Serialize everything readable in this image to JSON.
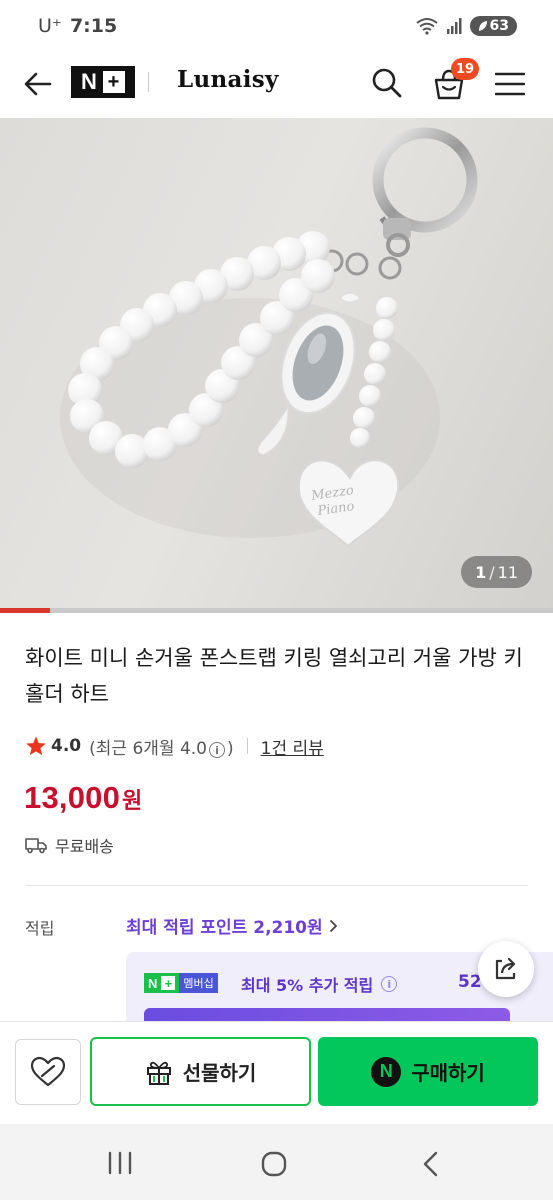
{
  "status_bar": {
    "carrier": "U⁺",
    "time": "7:15",
    "battery": "63"
  },
  "header": {
    "logo_text": "N",
    "logo_plus": "+",
    "store_name": "Lunaisy",
    "cart_count": "19"
  },
  "gallery": {
    "current": "1",
    "separator": "/",
    "total": "11",
    "progress_fraction": 0.091
  },
  "product": {
    "title": "화이트 미니 손거울 폰스트랩 키링 열쇠고리 거울 가방 키홀더 하트",
    "rating": "4.0",
    "recent_rating": "(최근 6개월 4.0",
    "recent_rating_close": ")",
    "review_count": "1건 리뷰",
    "price": "13,000",
    "currency": "원",
    "shipping": "무료배송"
  },
  "points": {
    "label": "적립",
    "max_points": "최대 적립 포인트 2,210원",
    "membership_np": "N",
    "membership_plus": "+",
    "membership_label": "멤버십",
    "membership_text": "최대 5% 추가 적립",
    "membership_amount": "52"
  },
  "actions": {
    "gift_label": "선물하기",
    "buy_label": "구매하기",
    "buy_icon_letter": "N"
  },
  "colors": {
    "accent_green": "#03c75a",
    "price_red": "#c8102e",
    "points_purple": "#6d3fd6",
    "badge_orange": "#f04a23"
  },
  "icons": {
    "back": "arrow-left-icon",
    "search": "search-icon",
    "cart": "shopping-bag-icon",
    "menu": "hamburger-menu-icon",
    "star": "star-icon",
    "info": "info-icon",
    "shipping": "truck-icon",
    "share": "share-icon",
    "wish": "heart-icon",
    "gift": "gift-icon"
  }
}
